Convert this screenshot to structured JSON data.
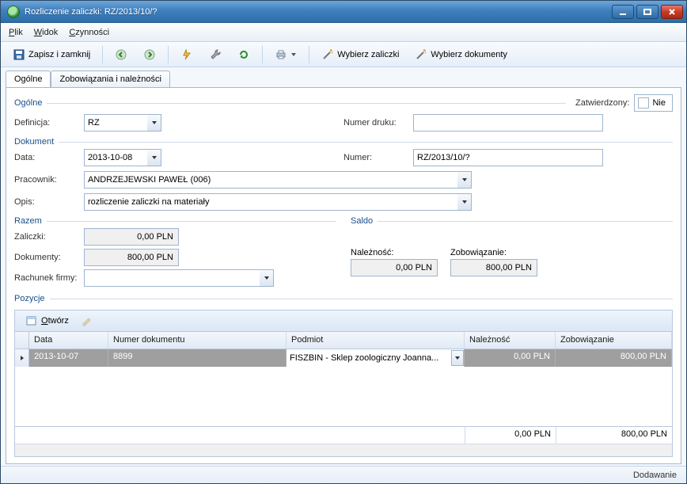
{
  "window": {
    "title": "Rozliczenie zaliczki: RZ/2013/10/?"
  },
  "menu": {
    "plik": "Plik",
    "widok": "Widok",
    "czynnosci": "Czynności"
  },
  "toolbar": {
    "save_close": "Zapisz i zamknij",
    "wybierz_zaliczki": "Wybierz zaliczki",
    "wybierz_dokumenty": "Wybierz dokumenty"
  },
  "tabs": {
    "ogolne": "Ogólne",
    "zobow": "Zobowiązania i należności"
  },
  "groups": {
    "ogolne": "Ogólne",
    "dokument": "Dokument",
    "razem": "Razem",
    "saldo": "Saldo",
    "pozycje": "Pozycje"
  },
  "labels": {
    "zatwierdzony": "Zatwierdzony:",
    "nie": "Nie",
    "definicja": "Definicja:",
    "numer_druku": "Numer druku:",
    "data": "Data:",
    "numer": "Numer:",
    "pracownik": "Pracownik:",
    "opis": "Opis:",
    "zaliczki": "Zaliczki:",
    "dokumenty": "Dokumenty:",
    "rachunek_firmy": "Rachunek firmy:",
    "naleznosc": "Należność:",
    "zobowiazanie": "Zobowiązanie:",
    "otworz": "Otwórz"
  },
  "values": {
    "definicja": "RZ",
    "numer_druku": "",
    "data": "2013-10-08",
    "numer": "RZ/2013/10/?",
    "pracownik": "ANDRZEJEWSKI PAWEŁ (006)",
    "opis": "rozliczenie zaliczki na materiały",
    "zaliczki": "0,00 PLN",
    "dokumenty_kwota": "800,00 PLN",
    "rachunek_firmy": "",
    "naleznosc": "0,00 PLN",
    "zobowiazanie": "800,00 PLN"
  },
  "grid": {
    "headers": {
      "data": "Data",
      "numer_dokumentu": "Numer dokumentu",
      "podmiot": "Podmiot",
      "naleznosc": "Należność",
      "zobowiazanie": "Zobowiązanie"
    },
    "rows": [
      {
        "data": "2013-10-07",
        "numer_dokumentu": "8899",
        "podmiot": "FISZBIN - Sklep zoologiczny  Joanna...",
        "naleznosc": "0,00 PLN",
        "zobowiazanie": "800,00 PLN"
      }
    ],
    "totals": {
      "naleznosc": "0,00 PLN",
      "zobowiazanie": "800,00 PLN"
    }
  },
  "status": "Dodawanie"
}
